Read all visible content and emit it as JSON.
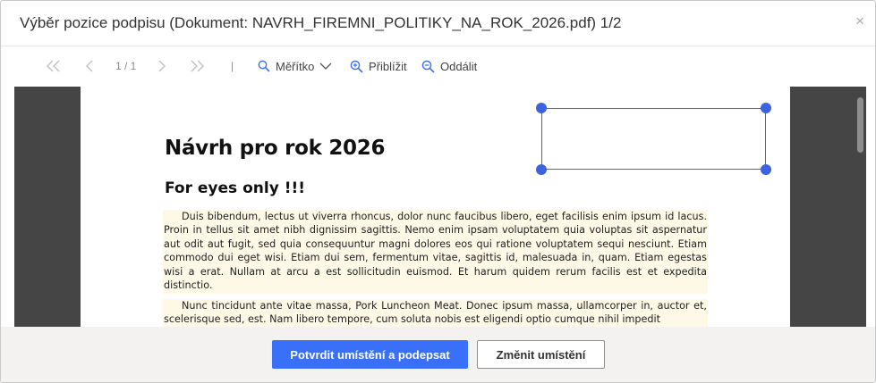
{
  "dialog": {
    "title": "Výběr pozice podpisu (Dokument: NAVRH_FIREMNI_POLITIKY_NA_ROK_2026.pdf) 1/2",
    "close_glyph": "×"
  },
  "toolbar": {
    "page_indicator": "1 / 1",
    "separator": "|",
    "scale_label": "Měřítko",
    "zoom_in_label": "Přiblížit",
    "zoom_out_label": "Oddálit",
    "icons": [
      "first-page-icon",
      "previous-page-icon",
      "next-page-icon",
      "last-page-icon",
      "scale-search-icon",
      "chevron-down-icon",
      "zoom-in-icon",
      "zoom-out-icon"
    ]
  },
  "document": {
    "heading": "Návrh pro rok 2026",
    "subheading": "For eyes only !!!",
    "paragraphs": [
      "Duis bibendum, lectus ut viverra rhoncus, dolor nunc faucibus libero, eget facilisis enim ipsum id lacus. Proin in tellus sit amet nibh dignissim sagittis. Nemo enim ipsam voluptatem quia voluptas sit aspernatur aut odit aut fugit, sed quia consequuntur magni dolores eos qui ratione voluptatem sequi nesciunt. Etiam commodo dui eget wisi. Etiam dui sem, fermentum vitae, sagittis id, malesuada in, quam. Etiam egestas wisi a erat. Nullam at arcu a est sollicitudin euismod. Et harum quidem rerum facilis est et expedita distinctio.",
      "Nunc tincidunt ante vitae massa, Pork Luncheon Meat. Donec ipsum massa, ullamcorper in, auctor et, scelerisque sed, est. Nam libero tempore, cum soluta nobis est eligendi optio cumque nihil impedit"
    ]
  },
  "footer": {
    "confirm_label": "Potvrdit umístění a podepsat",
    "change_label": "Změnit umístění"
  },
  "colors": {
    "accent": "#3a6ff7",
    "selection": "#3b63e0",
    "viewer_bg": "#454545",
    "highlight": "#fdf9e6"
  }
}
